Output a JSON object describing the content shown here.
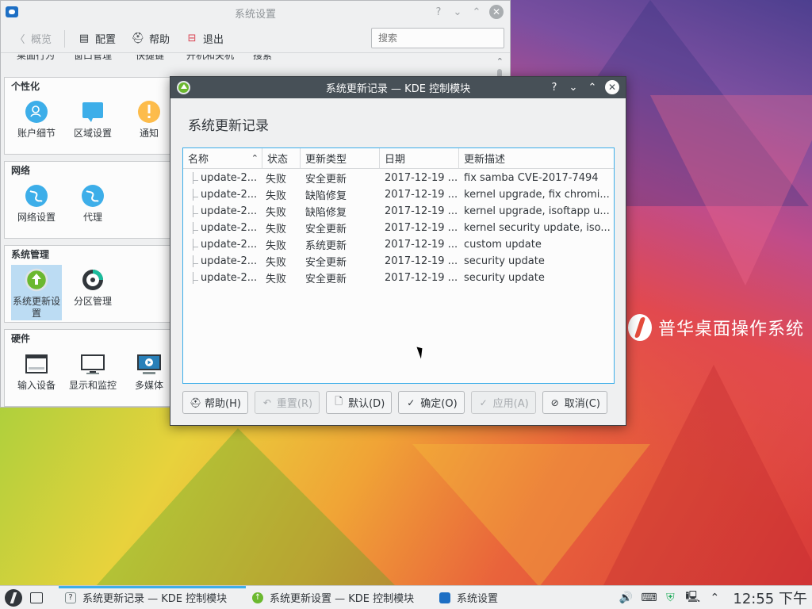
{
  "settings_window": {
    "title": "系统设置",
    "toolbar": {
      "back": "概览",
      "configure": "配置",
      "help": "帮助",
      "quit": "退出"
    },
    "search_placeholder": "搜索",
    "cut_row_labels": [
      "桌面行为",
      "窗口管理",
      "快捷键",
      "开机和关机",
      "搜索"
    ],
    "categories": [
      {
        "title": "个性化",
        "items": [
          {
            "label": "账户细节",
            "icon": "account-icon"
          },
          {
            "label": "区域设置",
            "icon": "locale-icon"
          },
          {
            "label": "通知",
            "icon": "notification-icon"
          }
        ]
      },
      {
        "title": "网络",
        "items": [
          {
            "label": "网络设置",
            "icon": "globe-icon"
          },
          {
            "label": "代理",
            "icon": "globe-icon"
          }
        ]
      },
      {
        "title": "系统管理",
        "items": [
          {
            "label": "系统更新设置",
            "icon": "update-icon"
          },
          {
            "label": "分区管理",
            "icon": "partition-icon"
          }
        ]
      },
      {
        "title": "硬件",
        "items": [
          {
            "label": "输入设备",
            "icon": "keyboard-icon"
          },
          {
            "label": "显示和监控",
            "icon": "monitor-icon"
          },
          {
            "label": "多媒体",
            "icon": "multimedia-icon"
          }
        ]
      }
    ]
  },
  "dialog": {
    "title": "系统更新记录 — KDE 控制模块",
    "heading": "系统更新记录",
    "columns": [
      "名称",
      "状态",
      "更新类型",
      "日期",
      "更新描述"
    ],
    "rows": [
      {
        "name": "update-2...",
        "status": "失败",
        "type": "安全更新",
        "date": "2017-12-19 ...",
        "desc": "fix samba CVE-2017-7494"
      },
      {
        "name": "update-2...",
        "status": "失败",
        "type": "缺陷修复",
        "date": "2017-12-19 ...",
        "desc": "kernel upgrade, fix chromi..."
      },
      {
        "name": "update-2...",
        "status": "失败",
        "type": "缺陷修复",
        "date": "2017-12-19 ...",
        "desc": "kernel upgrade, isoftapp u..."
      },
      {
        "name": "update-2...",
        "status": "失败",
        "type": "安全更新",
        "date": "2017-12-19 ...",
        "desc": "kernel security update, iso..."
      },
      {
        "name": "update-2...",
        "status": "失败",
        "type": "系统更新",
        "date": "2017-12-19 ...",
        "desc": "custom update"
      },
      {
        "name": "update-2...",
        "status": "失败",
        "type": "安全更新",
        "date": "2017-12-19 ...",
        "desc": "security update"
      },
      {
        "name": "update-2...",
        "status": "失败",
        "type": "安全更新",
        "date": "2017-12-19 ...",
        "desc": "security update"
      }
    ],
    "buttons": {
      "help": "帮助(H)",
      "reset": "重置(R)",
      "defaults": "默认(D)",
      "ok": "确定(O)",
      "apply": "应用(A)",
      "cancel": "取消(C)"
    }
  },
  "desktop": {
    "brand_text": "普华桌面操作系统"
  },
  "taskbar": {
    "tasks": [
      {
        "label": "系统更新记录 — KDE 控制模块",
        "active": true
      },
      {
        "label": "系统更新设置 — KDE 控制模块",
        "active": false
      },
      {
        "label": "系统设置",
        "active": false
      }
    ],
    "clock": "12:55 下午"
  },
  "colors": {
    "accent": "#3daee9",
    "dialog_titlebar": "#475057",
    "selected_item": "#bcdcf3"
  }
}
